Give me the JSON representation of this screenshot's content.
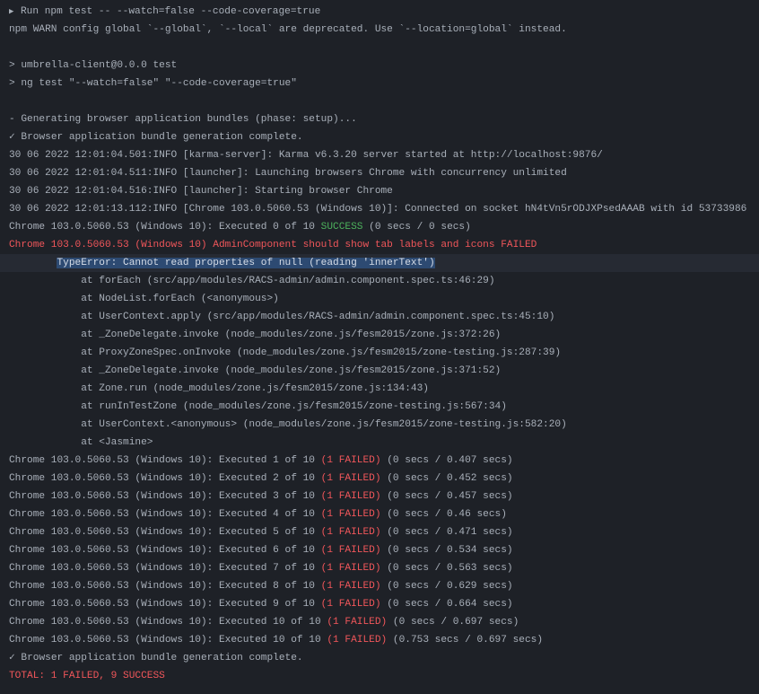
{
  "run_header": {
    "icon": "play-triangle-icon",
    "text": "Run npm test -- --watch=false --code-coverage=true"
  },
  "lines": {
    "warn": "npm WARN config global `--global`, `--local` are deprecated. Use `--location=global` instead.",
    "script_name": "> umbrella-client@0.0.0 test",
    "script_cmd": "> ng test \"--watch=false\" \"--code-coverage=true\"",
    "generating": "- Generating browser application bundles (phase: setup)...",
    "bundle_complete_1": "✓ Browser application bundle generation complete.",
    "karma_1": "30 06 2022 12:01:04.501:INFO [karma-server]: Karma v6.3.20 server started at http://localhost:9876/",
    "karma_2": "30 06 2022 12:01:04.511:INFO [launcher]: Launching browsers Chrome with concurrency unlimited",
    "karma_3": "30 06 2022 12:01:04.516:INFO [launcher]: Starting browser Chrome",
    "karma_4": "30 06 2022 12:01:13.112:INFO [Chrome 103.0.5060.53 (Windows 10)]: Connected on socket hN4tVn5rODJXPsedAAAB with id 53733986",
    "exec0_prefix": "Chrome 103.0.5060.53 (Windows 10): Executed 0 of 10 ",
    "exec0_status": "SUCCESS",
    "exec0_suffix": " (0 secs / 0 secs)",
    "fail_line": "Chrome 103.0.5060.53 (Windows 10) AdminComponent should show tab labels and icons FAILED",
    "error_indent": "        ",
    "error_text": "TypeError: Cannot read properties of null (reading 'innerText')",
    "bundle_complete_2": "✓ Browser application bundle generation complete.",
    "total": "TOTAL: 1 FAILED, 9 SUCCESS"
  },
  "stack": [
    "            at forEach (src/app/modules/RACS-admin/admin.component.spec.ts:46:29)",
    "            at NodeList.forEach (<anonymous>)",
    "            at UserContext.apply (src/app/modules/RACS-admin/admin.component.spec.ts:45:10)",
    "            at _ZoneDelegate.invoke (node_modules/zone.js/fesm2015/zone.js:372:26)",
    "            at ProxyZoneSpec.onInvoke (node_modules/zone.js/fesm2015/zone-testing.js:287:39)",
    "            at _ZoneDelegate.invoke (node_modules/zone.js/fesm2015/zone.js:371:52)",
    "            at Zone.run (node_modules/zone.js/fesm2015/zone.js:134:43)",
    "            at runInTestZone (node_modules/zone.js/fesm2015/zone-testing.js:567:34)",
    "            at UserContext.<anonymous> (node_modules/zone.js/fesm2015/zone-testing.js:582:20)",
    "            at <Jasmine>"
  ],
  "progress": [
    {
      "prefix": "Chrome 103.0.5060.53 (Windows 10): Executed 1 of 10 ",
      "status": "(1 FAILED)",
      "suffix": " (0 secs / 0.407 secs)"
    },
    {
      "prefix": "Chrome 103.0.5060.53 (Windows 10): Executed 2 of 10 ",
      "status": "(1 FAILED)",
      "suffix": " (0 secs / 0.452 secs)"
    },
    {
      "prefix": "Chrome 103.0.5060.53 (Windows 10): Executed 3 of 10 ",
      "status": "(1 FAILED)",
      "suffix": " (0 secs / 0.457 secs)"
    },
    {
      "prefix": "Chrome 103.0.5060.53 (Windows 10): Executed 4 of 10 ",
      "status": "(1 FAILED)",
      "suffix": " (0 secs / 0.46 secs)"
    },
    {
      "prefix": "Chrome 103.0.5060.53 (Windows 10): Executed 5 of 10 ",
      "status": "(1 FAILED)",
      "suffix": " (0 secs / 0.471 secs)"
    },
    {
      "prefix": "Chrome 103.0.5060.53 (Windows 10): Executed 6 of 10 ",
      "status": "(1 FAILED)",
      "suffix": " (0 secs / 0.534 secs)"
    },
    {
      "prefix": "Chrome 103.0.5060.53 (Windows 10): Executed 7 of 10 ",
      "status": "(1 FAILED)",
      "suffix": " (0 secs / 0.563 secs)"
    },
    {
      "prefix": "Chrome 103.0.5060.53 (Windows 10): Executed 8 of 10 ",
      "status": "(1 FAILED)",
      "suffix": " (0 secs / 0.629 secs)"
    },
    {
      "prefix": "Chrome 103.0.5060.53 (Windows 10): Executed 9 of 10 ",
      "status": "(1 FAILED)",
      "suffix": " (0 secs / 0.664 secs)"
    },
    {
      "prefix": "Chrome 103.0.5060.53 (Windows 10): Executed 10 of 10 ",
      "status": "(1 FAILED)",
      "suffix": " (0 secs / 0.697 secs)"
    },
    {
      "prefix": "Chrome 103.0.5060.53 (Windows 10): Executed 10 of 10 ",
      "status": "(1 FAILED)",
      "suffix": " (0.753 secs / 0.697 secs)"
    }
  ],
  "colors": {
    "background": "#1e2127",
    "text": "#a9b0ba",
    "error": "#f0565a",
    "success": "#4cb05c",
    "selection": "#2d4a72"
  }
}
